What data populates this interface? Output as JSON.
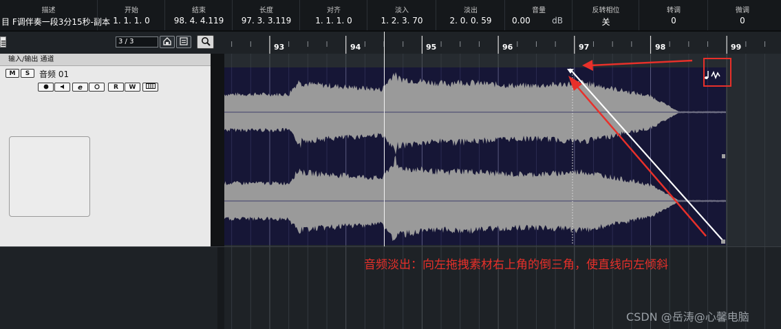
{
  "info_line": {
    "columns": [
      {
        "header": "描述",
        "value": "目 F调伴奏一段3分15秒-副本"
      },
      {
        "header": "开始",
        "value": "1. 1. 1.   0"
      },
      {
        "header": "结束",
        "value": "98. 4. 4.119"
      },
      {
        "header": "长度",
        "value": "97. 3. 3.119"
      },
      {
        "header": "对齐",
        "value": "1. 1. 1.   0"
      },
      {
        "header": "淡入",
        "value": "1. 2. 3. 70"
      },
      {
        "header": "淡出",
        "value": "2. 0. 0. 59"
      },
      {
        "header": "音量",
        "value": "0.00",
        "unit": "dB"
      },
      {
        "header": "反转相位",
        "value": "关"
      },
      {
        "header": "转调",
        "value": "0"
      },
      {
        "header": "微调",
        "value": "0"
      }
    ]
  },
  "inspector": {
    "counter": "3 / 3",
    "section_title": "输入/输出 通道",
    "track_name": "音频 01",
    "mute_label": "M",
    "solo_label": "S",
    "read_label": "R",
    "write_label": "W"
  },
  "ruler": {
    "bars": [
      "93",
      "94",
      "95",
      "96",
      "97",
      "98",
      "99"
    ]
  },
  "annotation": "音频淡出：向左拖拽素材右上角的倒三角，使直线向左倾斜",
  "watermark": "CSDN @岳涛@心馨电脑",
  "colors": {
    "event_bg": "#161636",
    "waveform": "#9a9a9a",
    "annotation_red": "#e8302a",
    "fade_line": "#ffffff"
  }
}
